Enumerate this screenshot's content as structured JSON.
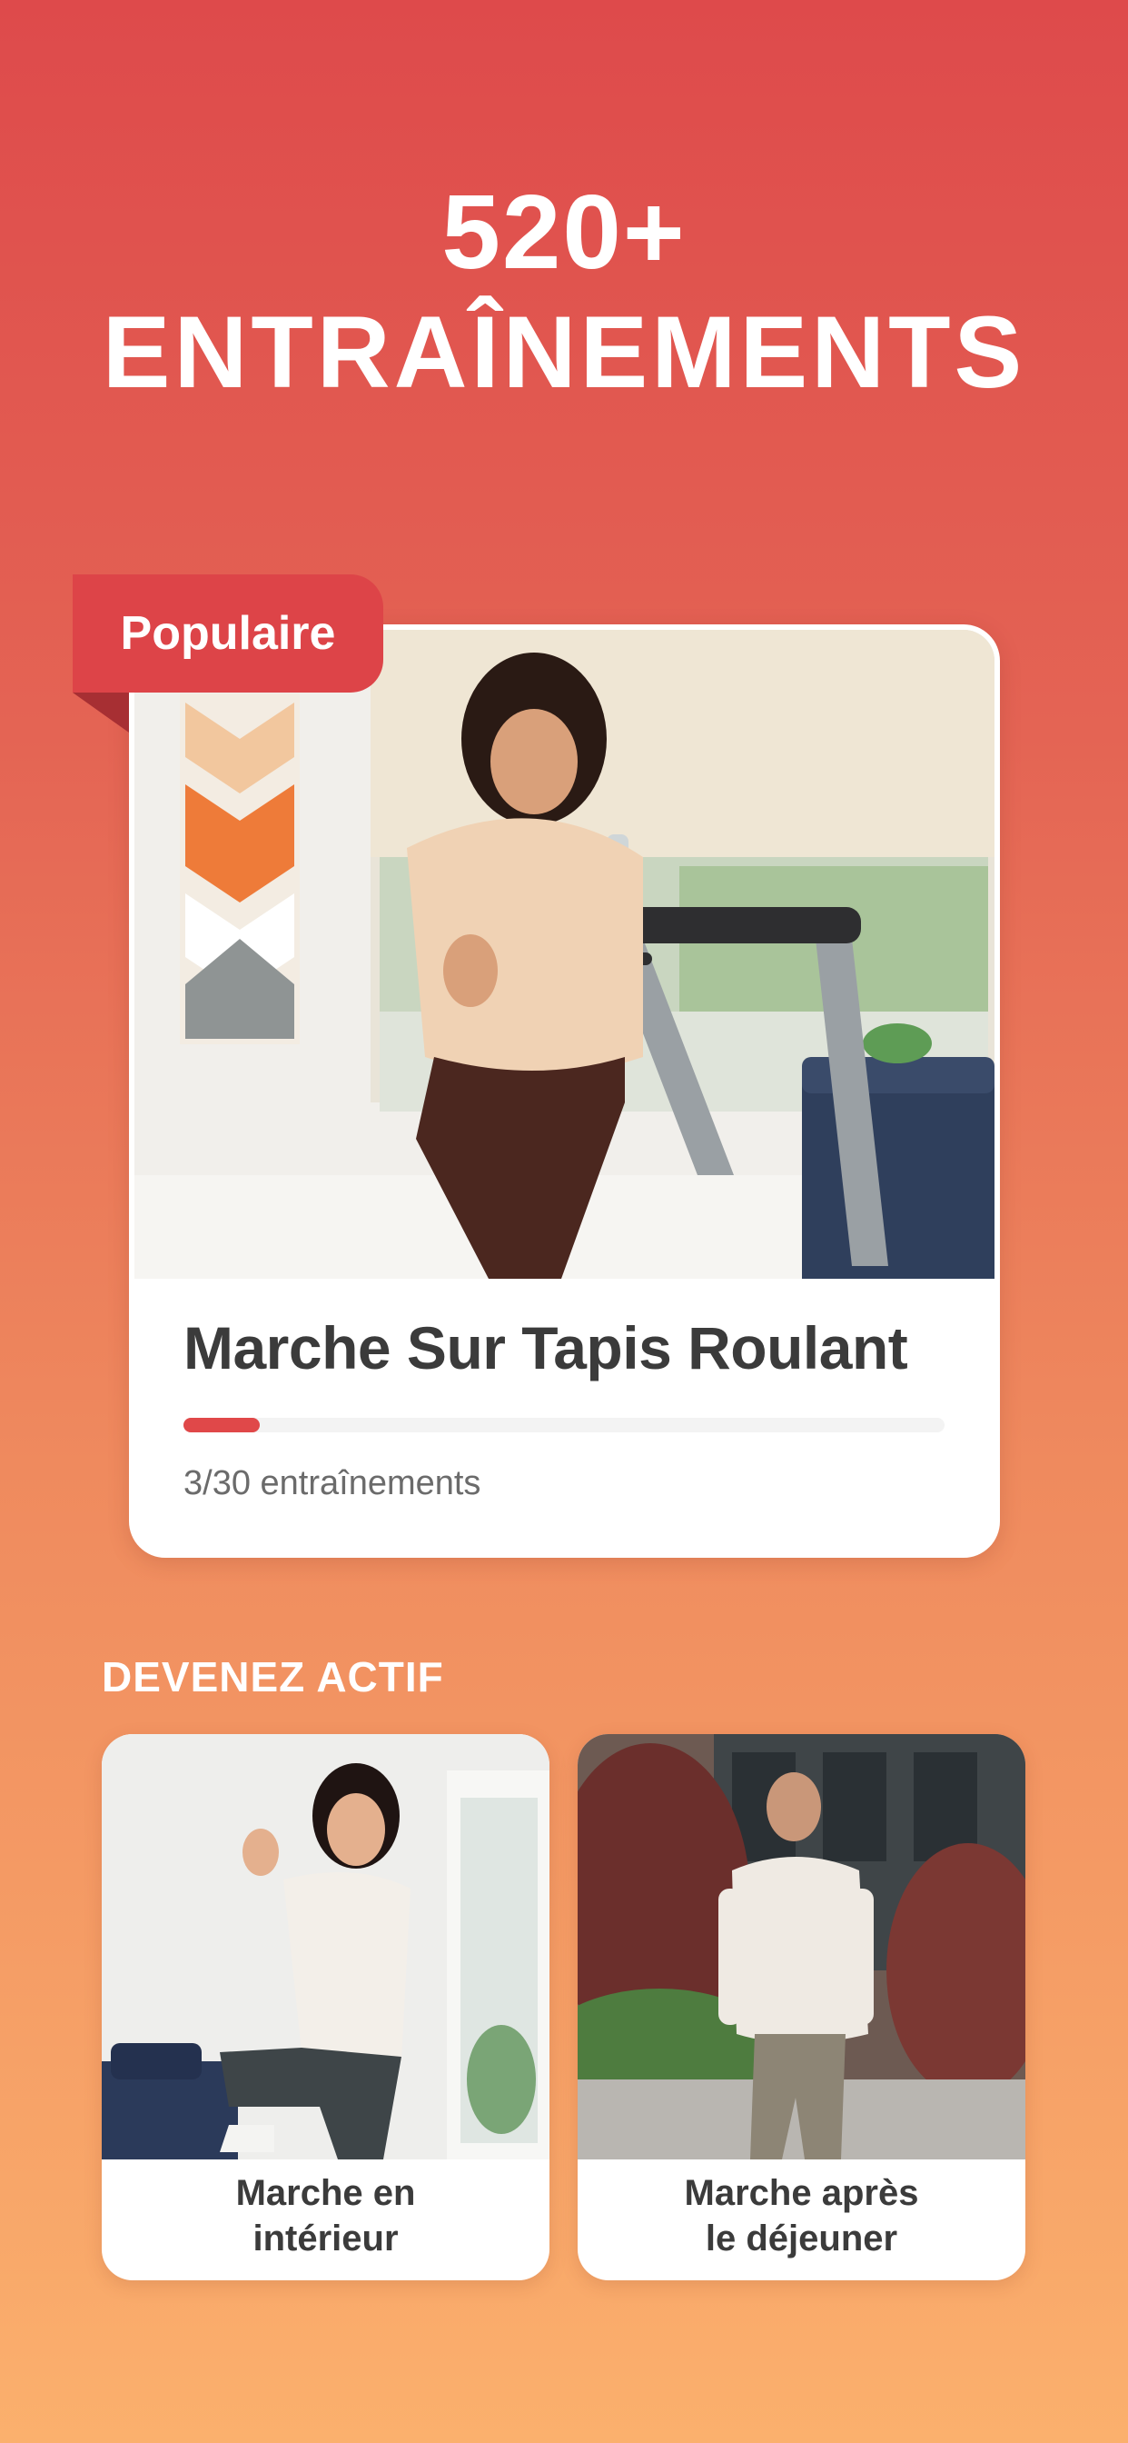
{
  "headline": {
    "count": "520+",
    "word": "ENTRAÎNEMENTS"
  },
  "featured": {
    "badge": "Populaire",
    "title": "Marche Sur Tapis Roulant",
    "progress_text": "3/30 entraînements",
    "progress_fraction": 0.1,
    "photo_icon": "woman-on-treadmill-photo"
  },
  "section": {
    "title": "DEVENEZ ACTIF"
  },
  "cards": [
    {
      "line1": "Marche en",
      "line2": "intérieur",
      "photo_icon": "indoor-walking-photo"
    },
    {
      "line1": "Marche après",
      "line2": "le déjeuner",
      "photo_icon": "outdoor-walking-photo"
    }
  ],
  "colors": {
    "accent": "#dd4448",
    "gradient_top": "#de4a4b",
    "gradient_bottom": "#fbb06d"
  }
}
